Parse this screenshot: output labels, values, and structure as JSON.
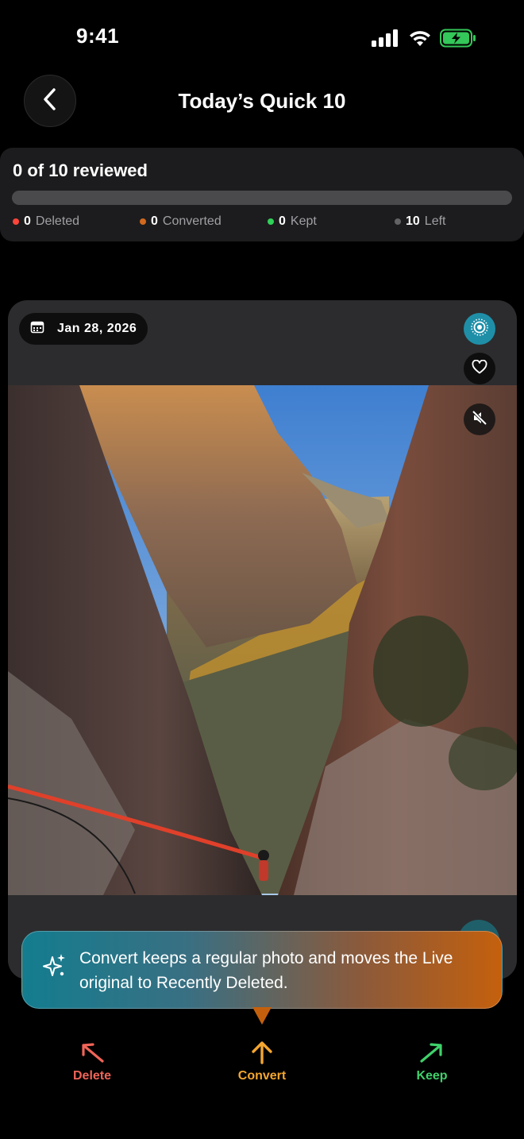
{
  "status_bar": {
    "time": "9:41"
  },
  "header": {
    "title": "Today’s Quick 10"
  },
  "progress": {
    "title": "0 of 10 reviewed",
    "fraction_reviewed": 0,
    "stats": [
      {
        "count": "0",
        "label": "Deleted",
        "color": "#ff453a"
      },
      {
        "count": "0",
        "label": "Converted",
        "color": "#d2691e"
      },
      {
        "count": "0",
        "label": "Kept",
        "color": "#30d158"
      },
      {
        "count": "10",
        "label": "Left",
        "color": "#636366"
      }
    ]
  },
  "photo_card": {
    "date": "Jan 28, 2026"
  },
  "tooltip": {
    "text": "Convert keeps a regular photo and moves the Live original to Recently Deleted."
  },
  "actions": {
    "delete": "Delete",
    "convert": "Convert",
    "keep": "Keep"
  },
  "colors": {
    "delete": "#f06458",
    "convert": "#f4a630",
    "keep": "#3fd16b",
    "live_accent": "#1f8fa8"
  }
}
